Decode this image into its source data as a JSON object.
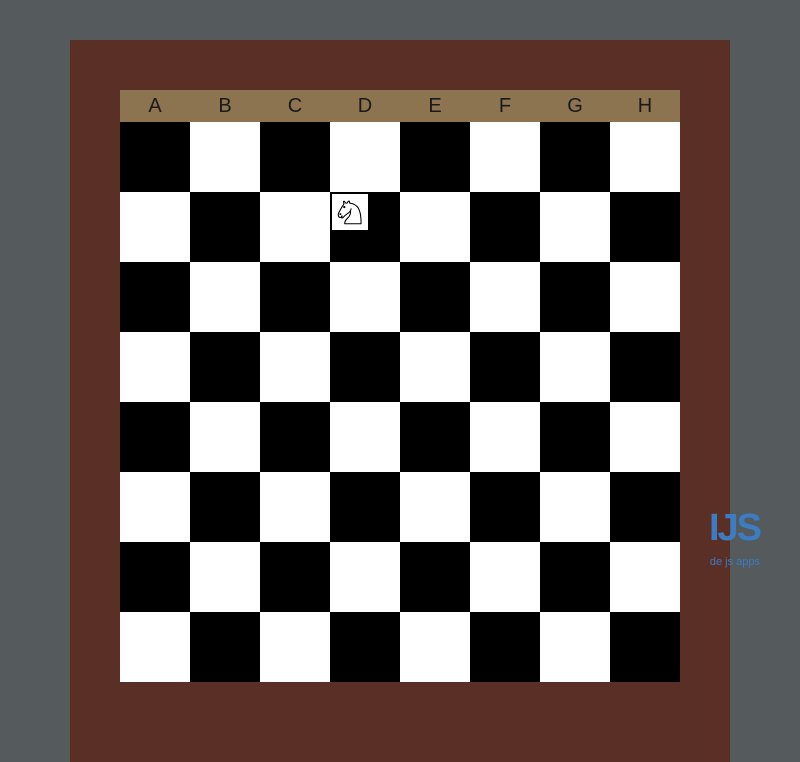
{
  "board": {
    "files": [
      "A",
      "B",
      "C",
      "D",
      "E",
      "F",
      "G",
      "H"
    ],
    "ranks": 8,
    "light_color": "#ffffff",
    "dark_color": "#000000",
    "frame_color": "#5a2f26",
    "label_bg": "#8d7450",
    "pieces": [
      {
        "file": "D",
        "rank": 2,
        "piece": "knight",
        "color": "white"
      }
    ]
  },
  "watermark": {
    "logo": "IJS",
    "sub": "de js apps"
  }
}
